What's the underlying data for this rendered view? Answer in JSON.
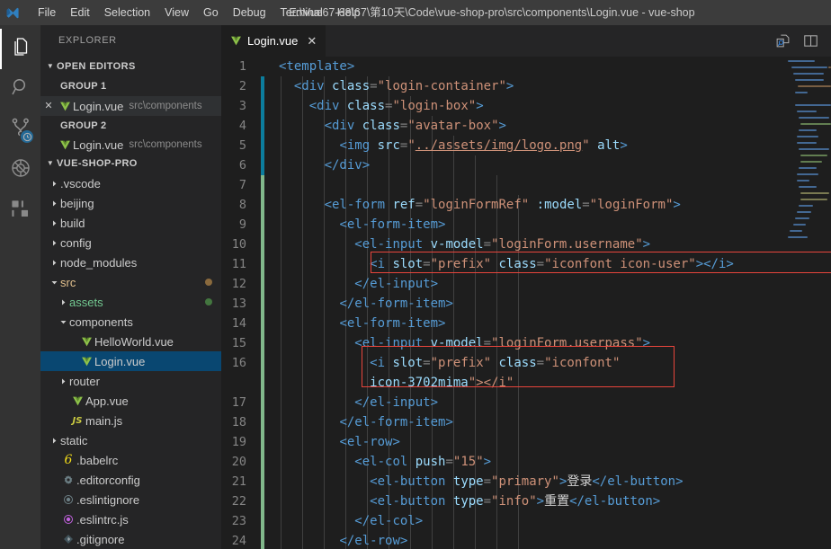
{
  "window": {
    "title": "E:\\Vue67-68\\67\\第10天\\Code\\vue-shop-pro\\src\\components\\Login.vue - vue-shop",
    "logo_icon": "vscode-logo"
  },
  "menubar": {
    "items": [
      {
        "label": "File",
        "name": "menu-file"
      },
      {
        "label": "Edit",
        "name": "menu-edit"
      },
      {
        "label": "Selection",
        "name": "menu-selection"
      },
      {
        "label": "View",
        "name": "menu-view"
      },
      {
        "label": "Go",
        "name": "menu-go"
      },
      {
        "label": "Debug",
        "name": "menu-debug"
      },
      {
        "label": "Terminal",
        "name": "menu-terminal"
      },
      {
        "label": "Help",
        "name": "menu-help"
      }
    ]
  },
  "activitybar": {
    "items": [
      {
        "icon": "files-explorer-icon",
        "name": "activity-explorer",
        "active": true
      },
      {
        "icon": "search-icon",
        "name": "activity-search",
        "active": false
      },
      {
        "icon": "source-control-icon",
        "name": "activity-source-control",
        "active": false,
        "badge": "clock-badge-icon"
      },
      {
        "icon": "debug-icon",
        "name": "activity-debug",
        "active": false
      },
      {
        "icon": "extensions-icon",
        "name": "activity-extensions",
        "active": false
      }
    ]
  },
  "sidebar": {
    "title": "EXPLORER",
    "open_editors": {
      "header": "OPEN EDITORS",
      "groups": [
        {
          "label": "GROUP 1",
          "items": [
            {
              "label": "Login.vue",
              "description": "src\\components",
              "icon": "vue-file-icon",
              "closable": true,
              "hovered": true
            }
          ]
        },
        {
          "label": "GROUP 2",
          "items": [
            {
              "label": "Login.vue",
              "description": "src\\components",
              "icon": "vue-file-icon",
              "closable": false,
              "hovered": false
            }
          ]
        }
      ]
    },
    "project": {
      "header": "VUE-SHOP-PRO",
      "tree": [
        {
          "label": ".vscode",
          "depth": 1,
          "kind": "folder",
          "expanded": false,
          "icon": "chevron-right-icon"
        },
        {
          "label": "beijing",
          "depth": 1,
          "kind": "folder",
          "expanded": false,
          "icon": "chevron-right-icon"
        },
        {
          "label": "build",
          "depth": 1,
          "kind": "folder",
          "expanded": false,
          "icon": "chevron-right-icon"
        },
        {
          "label": "config",
          "depth": 1,
          "kind": "folder",
          "expanded": false,
          "icon": "chevron-right-icon"
        },
        {
          "label": "node_modules",
          "depth": 1,
          "kind": "folder",
          "expanded": false,
          "icon": "chevron-right-icon"
        },
        {
          "label": "src",
          "depth": 1,
          "kind": "folder",
          "expanded": true,
          "icon": "chevron-down-icon",
          "status": "modified",
          "dot_color": "#8a6a3d"
        },
        {
          "label": "assets",
          "depth": 2,
          "kind": "folder",
          "expanded": false,
          "icon": "chevron-right-icon",
          "status": "added",
          "dot_color": "#43763f"
        },
        {
          "label": "components",
          "depth": 2,
          "kind": "folder",
          "expanded": true,
          "icon": "chevron-down-icon"
        },
        {
          "label": "HelloWorld.vue",
          "depth": 3,
          "kind": "file",
          "icon": "vue-file-icon"
        },
        {
          "label": "Login.vue",
          "depth": 3,
          "kind": "file",
          "icon": "vue-file-icon",
          "selected": true
        },
        {
          "label": "router",
          "depth": 2,
          "kind": "folder",
          "expanded": false,
          "icon": "chevron-right-icon"
        },
        {
          "label": "App.vue",
          "depth": 2,
          "kind": "file",
          "icon": "vue-file-icon"
        },
        {
          "label": "main.js",
          "depth": 2,
          "kind": "file",
          "icon": "js-file-icon"
        },
        {
          "label": "static",
          "depth": 1,
          "kind": "folder",
          "expanded": false,
          "icon": "chevron-right-icon"
        },
        {
          "label": ".babelrc",
          "depth": 1,
          "kind": "file",
          "icon": "babel-file-icon"
        },
        {
          "label": ".editorconfig",
          "depth": 1,
          "kind": "file",
          "icon": "gear-icon"
        },
        {
          "label": ".eslintignore",
          "depth": 1,
          "kind": "file",
          "icon": "eslint-ignore-icon"
        },
        {
          "label": ".eslintrc.js",
          "depth": 1,
          "kind": "file",
          "icon": "eslint-file-icon"
        },
        {
          "label": ".gitignore",
          "depth": 1,
          "kind": "file",
          "icon": "git-file-icon"
        }
      ]
    }
  },
  "editor": {
    "tabs": [
      {
        "label": "Login.vue",
        "icon": "vue-file-icon",
        "active": true,
        "close_icon": "close-icon"
      }
    ],
    "actions": [
      {
        "name": "open-preview-button",
        "icon": "preview-magnifier-icon"
      },
      {
        "name": "split-editor-button",
        "icon": "split-editor-icon"
      }
    ],
    "lines": [
      {
        "n": 1,
        "change": "none",
        "wrapped": false
      },
      {
        "n": 2,
        "change": "modified",
        "wrapped": false
      },
      {
        "n": 3,
        "change": "modified",
        "wrapped": false
      },
      {
        "n": 4,
        "change": "modified",
        "wrapped": false
      },
      {
        "n": 5,
        "change": "modified",
        "wrapped": false
      },
      {
        "n": 6,
        "change": "modified",
        "wrapped": false
      },
      {
        "n": 7,
        "change": "added",
        "wrapped": false
      },
      {
        "n": 8,
        "change": "added",
        "wrapped": false
      },
      {
        "n": 9,
        "change": "added",
        "wrapped": false
      },
      {
        "n": 10,
        "change": "added",
        "wrapped": false
      },
      {
        "n": 11,
        "change": "added",
        "wrapped": false
      },
      {
        "n": 12,
        "change": "added",
        "wrapped": false
      },
      {
        "n": 13,
        "change": "added",
        "wrapped": false
      },
      {
        "n": 14,
        "change": "added",
        "wrapped": false
      },
      {
        "n": 15,
        "change": "added",
        "wrapped": false
      },
      {
        "n": 16,
        "change": "added",
        "wrapped": true
      },
      {
        "n": 17,
        "change": "added",
        "wrapped": false
      },
      {
        "n": 18,
        "change": "added",
        "wrapped": false
      },
      {
        "n": 19,
        "change": "added",
        "wrapped": false
      },
      {
        "n": 20,
        "change": "added",
        "wrapped": false
      },
      {
        "n": 21,
        "change": "added",
        "wrapped": false
      },
      {
        "n": 22,
        "change": "added",
        "wrapped": false
      },
      {
        "n": 23,
        "change": "added",
        "wrapped": false
      },
      {
        "n": 24,
        "change": "added",
        "wrapped": false
      }
    ],
    "code_text": [
      "<template>",
      "  <div class=\"login-container\">",
      "    <div class=\"login-box\">",
      "      <div class=\"avatar-box\">",
      "        <img src=\"../assets/img/logo.png\" alt>",
      "      </div>",
      "",
      "      <el-form ref=\"loginFormRef\" :model=\"loginForm\">",
      "        <el-form-item>",
      "          <el-input v-model=\"loginForm.username\">",
      "            <i slot=\"prefix\" class=\"iconfont icon-user\"></i>",
      "          </el-input>",
      "        </el-form-item>",
      "        <el-form-item>",
      "          <el-input v-model=\"loginForm.userpass\">",
      "            <i slot=\"prefix\" class=\"iconfont icon-3702mima\"></i>",
      "          </el-input>",
      "        </el-form-item>",
      "        <el-row>",
      "          <el-col push=\"15\">",
      "            <el-button type=\"primary\">登录</el-button>",
      "            <el-button type=\"info\">重置</el-button>",
      "          </el-col>",
      "        </el-row>"
    ],
    "annotations": [
      {
        "name": "annotation-box-icon-user",
        "label": "icon-user highlight"
      },
      {
        "name": "annotation-box-icon-3702mima",
        "label": "icon-3702mima highlight"
      }
    ]
  },
  "colors": {
    "accent_selection": "#094771",
    "gutter_modified": "#0c7d9d",
    "gutter_added": "#81b88b",
    "annotation": "#e8453c",
    "vue_green": "#81c784",
    "titlebar": "#3c3c3c",
    "sidebar": "#252526",
    "editor": "#1e1e1e"
  }
}
